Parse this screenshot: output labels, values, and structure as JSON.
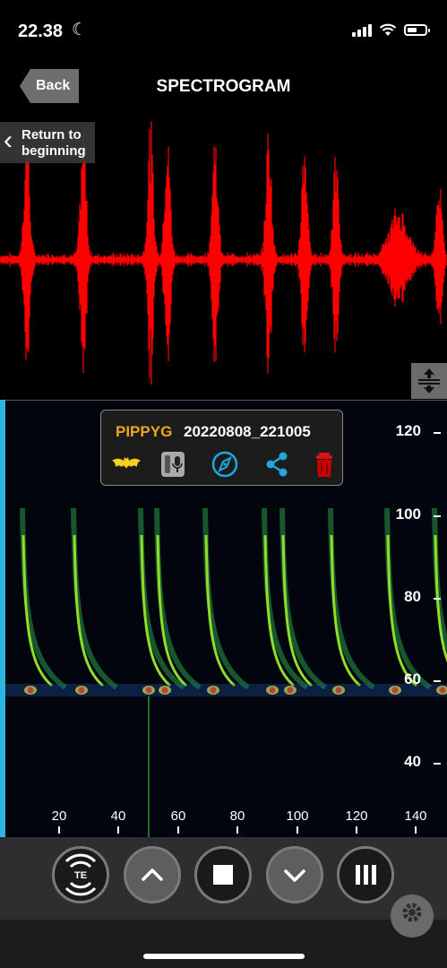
{
  "status_bar": {
    "time": "22.38",
    "moon_icon": "moon-icon",
    "signal_icon": "cellular-signal-icon",
    "wifi_icon": "wifi-icon",
    "battery_icon": "battery-icon"
  },
  "nav": {
    "back_label": "Back",
    "title": "SPECTROGRAM"
  },
  "waveform": {
    "return_label": "Return to beginning",
    "color": "#ff0000"
  },
  "recording": {
    "species": "PIPPYG",
    "filename": "20220808_221005",
    "species_color": "#f2a41d",
    "icons": [
      "bat-icon",
      "recorder-mic-icon",
      "compass-icon",
      "share-icon",
      "trash-icon"
    ]
  },
  "y_axis": {
    "labels": [
      "120",
      "100",
      "80",
      "60",
      "40"
    ]
  },
  "x_axis": {
    "labels": [
      "20",
      "40",
      "60",
      "80",
      "100",
      "120",
      "140"
    ]
  },
  "toolbar": {
    "buttons": [
      "te-mode-button",
      "scroll-up-button",
      "stop-button",
      "scroll-down-button",
      "pause-bars-button"
    ],
    "te_label": "TE"
  },
  "colors": {
    "accent": "#2bb5e0",
    "background": "#000000",
    "toolbar": "#2e2e30"
  }
}
